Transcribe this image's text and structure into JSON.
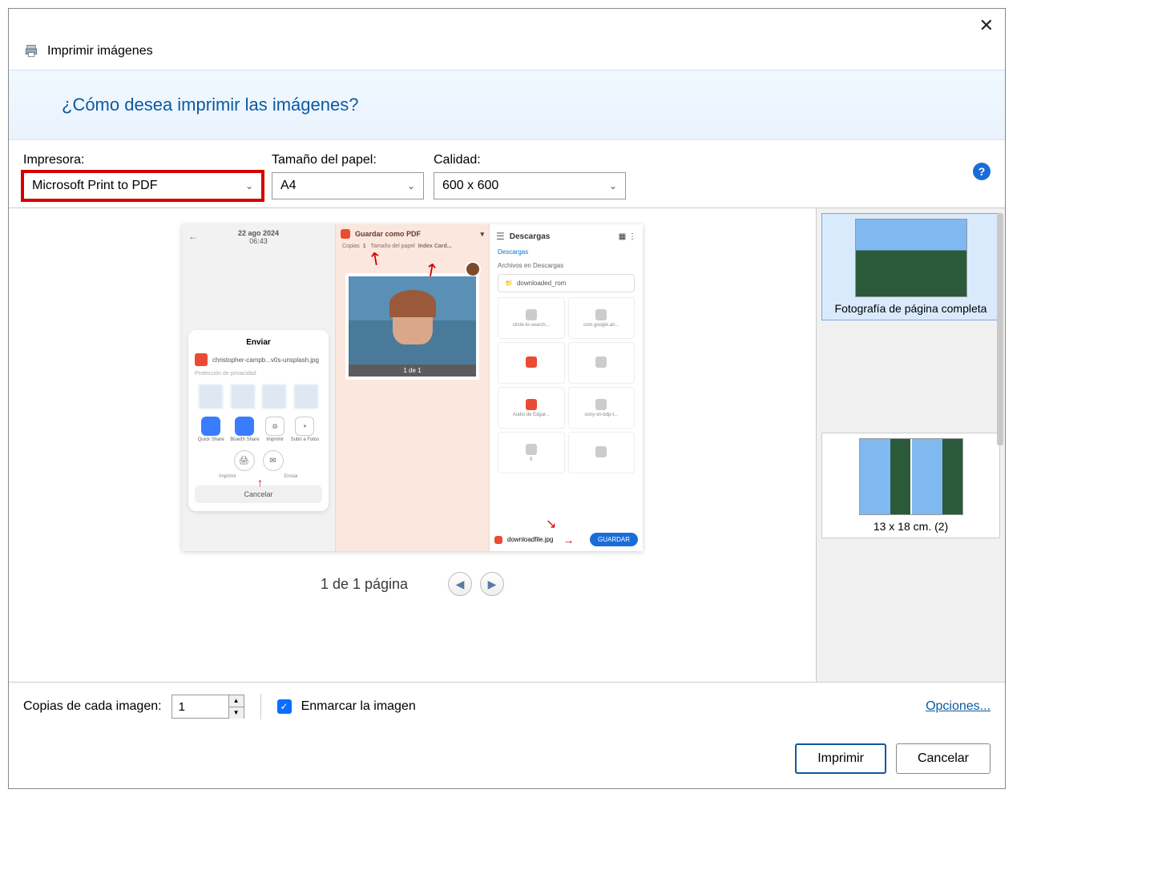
{
  "title": "Imprimir imágenes",
  "question": "¿Cómo desea imprimir las imágenes?",
  "settings": {
    "printer_label": "Impresora:",
    "printer_value": "Microsoft Print to PDF",
    "paper_label": "Tamaño del papel:",
    "paper_value": "A4",
    "quality_label": "Calidad:",
    "quality_value": "600 x 600"
  },
  "preview": {
    "left": {
      "date": "22 ago 2024",
      "time": "06:43",
      "share_title": "Enviar",
      "filename": "christopher-campb...v0s-unsplash.jpg",
      "privacy": "Protección de privacidad",
      "icons": [
        "Quick Share",
        "Bluetth Share",
        "Imprimir",
        "Subir a Fotos"
      ],
      "circ_labels": [
        "Imprimir",
        "Enviar"
      ],
      "cancel": "Cancelar"
    },
    "mid": {
      "top": "Guardar como PDF",
      "copies_label": "Copias",
      "copies_val": "1",
      "paper_label": "Tamaño del papel",
      "paper_val": "Index Card...",
      "photo_cap": "1 de 1"
    },
    "right": {
      "title": "Descargas",
      "link": "Descargas",
      "section": "Archivos en Descargas",
      "folder": "downloaded_rom",
      "files": [
        "circle-to-search...",
        "com.google.an...",
        "Audio de Edgar...",
        "sony-xn-bdp-t...",
        "5"
      ],
      "download_file": "downloadfile.jpg",
      "save_btn": "GUARDAR"
    }
  },
  "page_indicator": "1 de 1 página",
  "layouts": [
    {
      "label": "Fotografía de página completa"
    },
    {
      "label": "13 x 18 cm. (2)"
    }
  ],
  "footer": {
    "copies_label": "Copias de cada imagen:",
    "copies_value": "1",
    "frame_label": "Enmarcar la imagen",
    "options_link": "Opciones..."
  },
  "buttons": {
    "print": "Imprimir",
    "cancel": "Cancelar"
  }
}
